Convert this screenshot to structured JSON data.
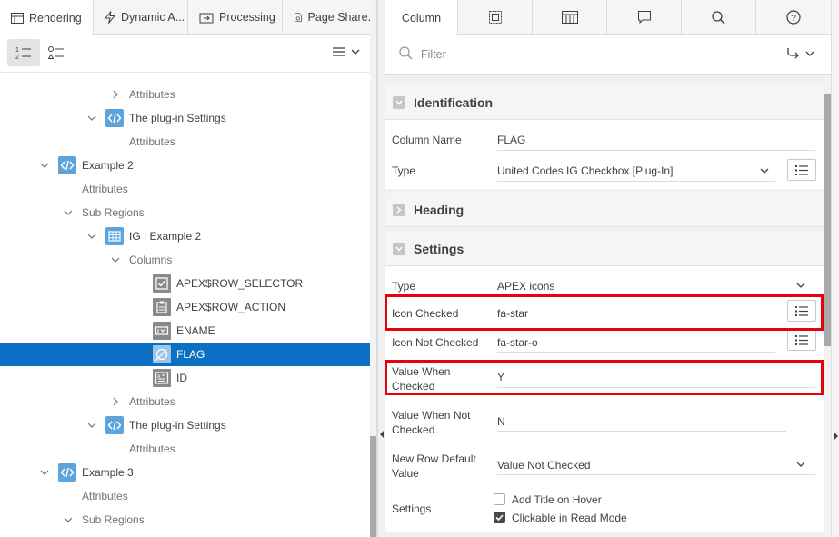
{
  "left_tabs": [
    {
      "label": "Rendering",
      "icon": "rendering-icon"
    },
    {
      "label": "Dynamic A...",
      "icon": "lightning-icon"
    },
    {
      "label": "Processing",
      "icon": "processing-icon"
    },
    {
      "label": "Page Share...",
      "icon": "shared-components-icon"
    }
  ],
  "tree": [
    {
      "label": "Attributes",
      "level": 6,
      "toggle": "collapsed",
      "icon": null
    },
    {
      "label": "The plug-in Settings",
      "level": 5,
      "toggle": "expanded",
      "icon": "code-icon"
    },
    {
      "label": "Attributes",
      "level": 6,
      "toggle": null,
      "icon": null
    },
    {
      "label": "Example 2",
      "level": 3,
      "toggle": "expanded",
      "icon": "code-icon"
    },
    {
      "label": "Attributes",
      "level": 4,
      "toggle": null,
      "icon": null
    },
    {
      "label": "Sub Regions",
      "level": 4,
      "toggle": "expanded",
      "icon": null
    },
    {
      "label": "IG | Example 2",
      "level": 5,
      "toggle": "expanded",
      "icon": "grid-icon"
    },
    {
      "label": "Columns",
      "level": 6,
      "toggle": "expanded",
      "icon": null
    },
    {
      "label": "APEX$ROW_SELECTOR",
      "level": 7,
      "toggle": null,
      "icon": "checkbox-column-icon"
    },
    {
      "label": "APEX$ROW_ACTION",
      "level": 7,
      "toggle": null,
      "icon": "clipboard-column-icon"
    },
    {
      "label": "ENAME",
      "level": 7,
      "toggle": null,
      "icon": "text-column-icon"
    },
    {
      "label": "FLAG",
      "level": 7,
      "toggle": null,
      "icon": "plugin-column-icon",
      "selected": true
    },
    {
      "label": "ID",
      "level": 7,
      "toggle": null,
      "icon": "number-column-icon"
    },
    {
      "label": "Attributes",
      "level": 6,
      "toggle": "collapsed",
      "icon": null
    },
    {
      "label": "The plug-in Settings",
      "level": 5,
      "toggle": "expanded",
      "icon": "code-icon"
    },
    {
      "label": "Attributes",
      "level": 6,
      "toggle": null,
      "icon": null
    },
    {
      "label": "Example 3",
      "level": 3,
      "toggle": "expanded",
      "icon": "code-icon"
    },
    {
      "label": "Attributes",
      "level": 4,
      "toggle": null,
      "icon": null
    },
    {
      "label": "Sub Regions",
      "level": 4,
      "toggle": "expanded",
      "icon": null
    }
  ],
  "right_tabs": [
    {
      "label": "Column",
      "icon": null
    },
    {
      "label": "",
      "icon": "region-icon"
    },
    {
      "label": "",
      "icon": "layout-icon"
    },
    {
      "label": "",
      "icon": "comment-icon"
    },
    {
      "label": "",
      "icon": "search-icon"
    },
    {
      "label": "",
      "icon": "help-icon"
    }
  ],
  "filter": {
    "placeholder": "Filter"
  },
  "groups": {
    "identification": {
      "title": "Identification",
      "column_name_label": "Column Name",
      "column_name_value": "FLAG",
      "type_label": "Type",
      "type_value": "United Codes IG Checkbox [Plug-In]"
    },
    "heading": {
      "title": "Heading"
    },
    "settings": {
      "title": "Settings",
      "type_label": "Type",
      "type_value": "APEX icons",
      "icon_checked_label": "Icon Checked",
      "icon_checked_value": "fa-star",
      "icon_not_checked_label": "Icon Not Checked",
      "icon_not_checked_value": "fa-star-o",
      "value_checked_label": "Value When Checked",
      "value_checked_value": "Y",
      "value_not_checked_label": "Value When Not Checked",
      "value_not_checked_value": "N",
      "new_row_label": "New Row Default Value",
      "new_row_value": "Value Not Checked",
      "settings_label": "Settings",
      "opt_add_title": "Add Title on Hover",
      "opt_add_title_checked": false,
      "opt_clickable": "Clickable in Read Mode",
      "opt_clickable_checked": true
    }
  },
  "colors": {
    "selection": "#0b6fc4",
    "highlight_border": "#e8000d",
    "icon_blue": "#5da3dc"
  }
}
